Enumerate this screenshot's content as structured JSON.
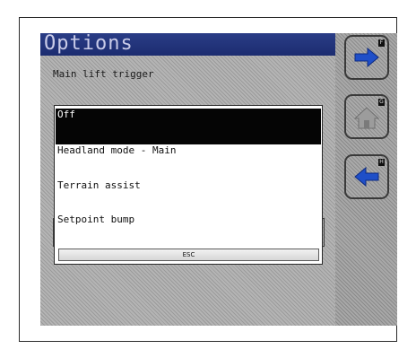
{
  "screen": {
    "title": "Options",
    "subtitle": "Main lift trigger"
  },
  "popup": {
    "options": [
      {
        "label": "Off",
        "selected": true
      },
      {
        "label": "Headland mode - Main",
        "selected": false
      },
      {
        "label": "Terrain assist",
        "selected": false
      },
      {
        "label": "Setpoint bump",
        "selected": false
      }
    ],
    "esc_label": "ESC"
  },
  "softkeys": [
    {
      "icon": "arrow-right-icon",
      "key": "F",
      "color": "#1f4fc8"
    },
    {
      "icon": "home-icon",
      "key": "G",
      "color": "#9c9c9c"
    },
    {
      "icon": "arrow-left-icon",
      "key": "H",
      "color": "#1f4fc8"
    }
  ]
}
